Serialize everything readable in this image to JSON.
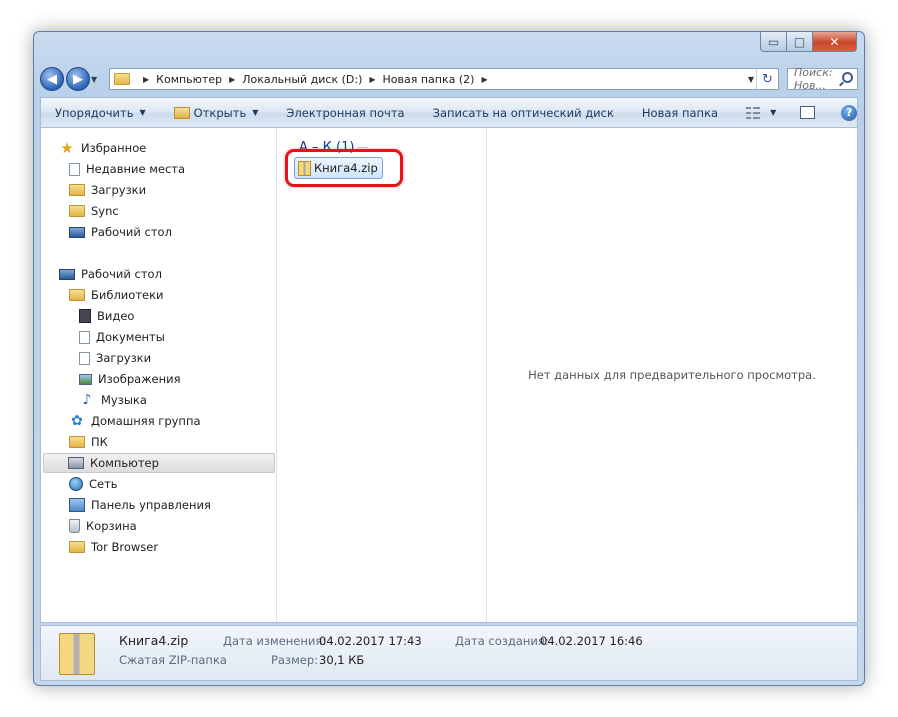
{
  "window": {
    "caption": {
      "minimize": "▭",
      "maximize": "□",
      "close": "✕"
    }
  },
  "address": {
    "crumbs": [
      "Компьютер",
      "Локальный диск (D:)",
      "Новая папка (2)"
    ],
    "search_placeholder": "Поиск: Нов..."
  },
  "toolbar": {
    "organize": "Упорядочить",
    "open": "Открыть",
    "email": "Электронная почта",
    "burn": "Записать на оптический диск",
    "new_folder": "Новая папка"
  },
  "sidebar": {
    "items": [
      {
        "label": "Избранное",
        "icon": "star-icon"
      },
      {
        "label": "Недавние места",
        "icon": "recent-places-icon"
      },
      {
        "label": "Загрузки",
        "icon": "folder-icon"
      },
      {
        "label": "Sync",
        "icon": "folder-icon"
      },
      {
        "label": "Рабочий стол",
        "icon": "desktop-icon"
      },
      {
        "label": "Рабочий стол",
        "icon": "desktop-icon"
      },
      {
        "label": "Библиотеки",
        "icon": "libraries-icon"
      },
      {
        "label": "Видео",
        "icon": "video-icon"
      },
      {
        "label": "Документы",
        "icon": "document-icon"
      },
      {
        "label": "Загрузки",
        "icon": "downloads-icon"
      },
      {
        "label": "Изображения",
        "icon": "image-icon"
      },
      {
        "label": "Музыка",
        "icon": "music-icon"
      },
      {
        "label": "Домашняя группа",
        "icon": "homegroup-icon"
      },
      {
        "label": "ПК",
        "icon": "user-folder-icon"
      },
      {
        "label": "Компьютер",
        "icon": "computer-icon"
      },
      {
        "label": "Сеть",
        "icon": "network-icon"
      },
      {
        "label": "Панель управления",
        "icon": "control-panel-icon"
      },
      {
        "label": "Корзина",
        "icon": "recycle-bin-icon"
      },
      {
        "label": "Tor Browser",
        "icon": "folder-icon"
      }
    ],
    "selected_index": 14
  },
  "files": {
    "group_header": "А – К (1)",
    "items": [
      {
        "name": "Книга4.zip"
      }
    ]
  },
  "preview": {
    "message": "Нет данных для предварительного просмотра."
  },
  "details": {
    "name": "Книга4.zip",
    "type": "Сжатая ZIP-папка",
    "modified_label": "Дата изменения:",
    "modified_value": "04.02.2017 17:43",
    "size_label": "Размер:",
    "size_value": "30,1 КБ",
    "created_label": "Дата создания:",
    "created_value": "04.02.2017 16:46"
  },
  "colors": {
    "highlight": "#e5121a",
    "selection": "#cfe5fb"
  }
}
